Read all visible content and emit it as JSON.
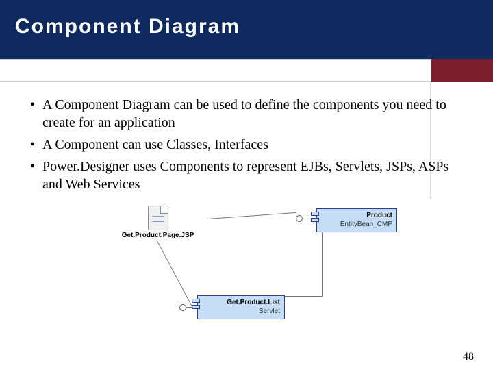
{
  "title": "Component Diagram",
  "bullets": [
    "A Component Diagram can be used to define the components you need to create for an application",
    "A Component can use Classes, Interfaces",
    "Power.Designer uses Components to represent EJBs, Servlets, JSPs, ASPs and Web Services"
  ],
  "diagram": {
    "jsp": {
      "label": "Get.Product.Page.JSP"
    },
    "product": {
      "title": "Product",
      "sub": "EntityBean_CMP"
    },
    "servlet": {
      "title": "Get.Product.List",
      "sub": "Servlet"
    }
  },
  "page_number": "48"
}
